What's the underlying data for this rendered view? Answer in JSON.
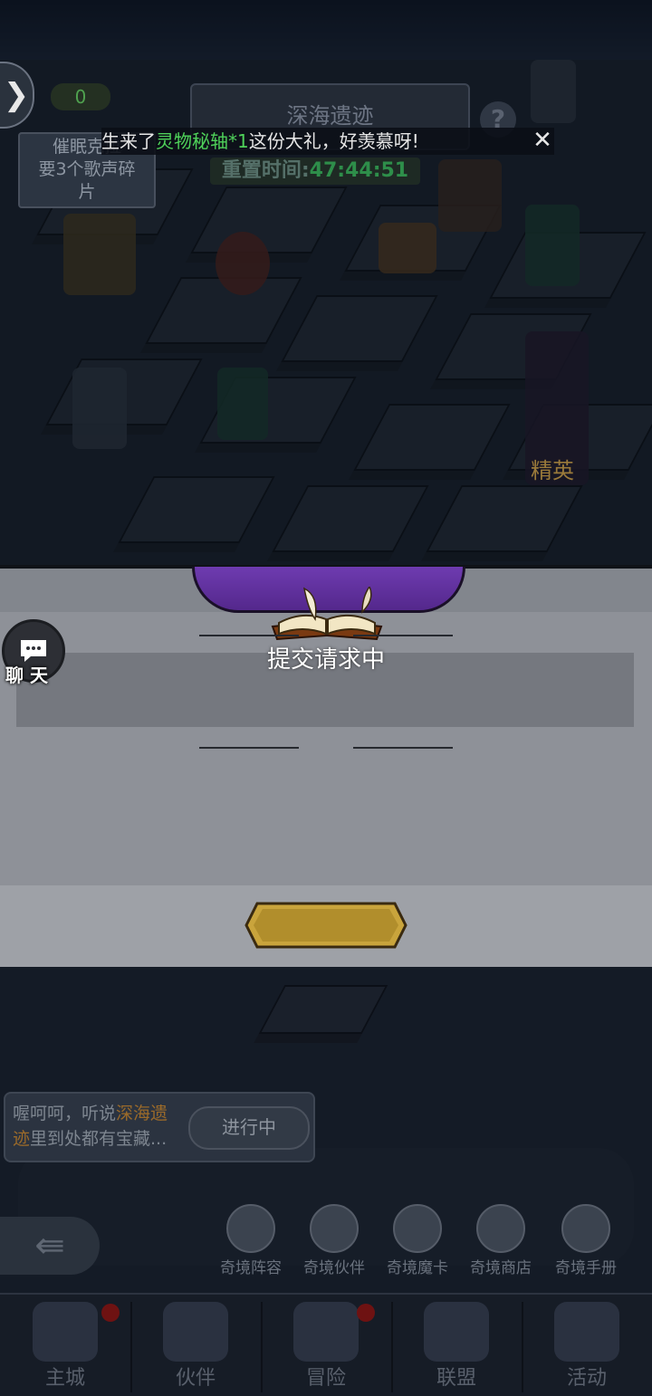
{
  "top": {
    "counter": "0",
    "side_card": [
      "催眠克拉",
      "要3个歌声碎",
      "片"
    ],
    "ruins_title": "深海遗迹",
    "reset_label": "重置时间:",
    "reset_time": "47:44:51",
    "help_glyph": "?",
    "elite_label": "精英"
  },
  "marquee": {
    "prefix": "生来了",
    "item": "灵物秘轴*1",
    "suffix": "这份大礼，好羡慕呀!",
    "close_glyph": "✕"
  },
  "modal": {
    "message": "提交请求中",
    "confirm_label": ""
  },
  "chat": {
    "label": "聊 天"
  },
  "quest": {
    "text_a": "喔呵呵，听说",
    "text_hl_a": "深海遗",
    "text_hl_b": "迹",
    "text_b": "里到处都有宝藏...",
    "status_label": "进行中"
  },
  "right_buttons": [
    "奇境阵容",
    "奇境伙伴",
    "奇境魔卡",
    "奇境商店",
    "奇境手册"
  ],
  "nav": {
    "items": [
      {
        "label": "主城",
        "badge": true
      },
      {
        "label": "伙伴",
        "badge": false
      },
      {
        "label": "冒险",
        "badge": true
      },
      {
        "label": "联盟",
        "badge": false
      },
      {
        "label": "活动",
        "badge": false
      }
    ]
  },
  "colors": {
    "item_highlight": "#4fd25a",
    "reset_time": "#2e8e4a",
    "modal_bg": "#8e9198",
    "banner": "#6e3bb0",
    "confirm_gold": "#c9a43c"
  }
}
